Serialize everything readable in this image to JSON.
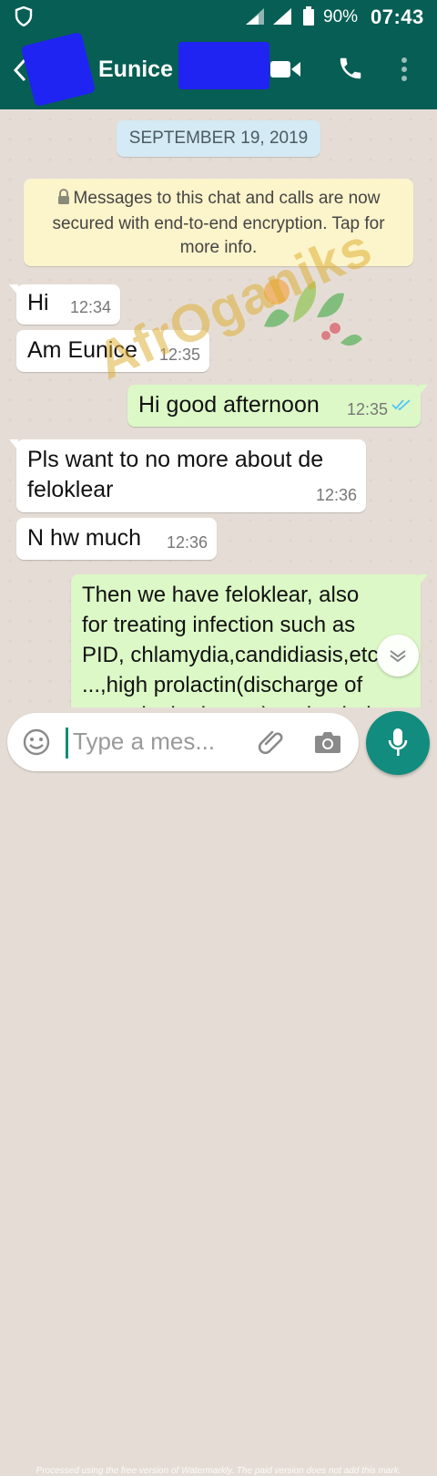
{
  "status_bar": {
    "battery": "90%",
    "time": "07:43"
  },
  "header": {
    "contact_name": "Eunice S"
  },
  "chat": {
    "date_chip": "SEPTEMBER 19, 2019",
    "encryption_line1": "Messages to this chat and calls are now",
    "encryption_line2": "secured with end-to-end encryption. Tap for",
    "encryption_line3": "more info.",
    "messages": [
      {
        "direction": "incoming",
        "line1": "Hi",
        "time": "12:34"
      },
      {
        "direction": "incoming",
        "line1": "Am Eunice",
        "time": "12:35"
      },
      {
        "direction": "outgoing",
        "line1": "Hi good afternoon",
        "time": "12:35",
        "status": "read"
      },
      {
        "direction": "incoming",
        "line1": "Pls want to no more about de",
        "line2": "feloklear",
        "time": "12:36"
      },
      {
        "direction": "incoming",
        "line1": "N hw much",
        "time": "12:36"
      },
      {
        "direction": "outgoing",
        "line1": "Then we have feloklear, also",
        "line2": "for treating infection such as",
        "line3": "PID, chlamydia,candidiasis,etc",
        "line4": "...,high prolactin(discharge of",
        "line5": "water in the breast) and to help"
      }
    ],
    "watermark_text": "AfrOganiks"
  },
  "composer": {
    "placeholder": "Type a mes...",
    "footnote": "Processed using the free version of Watermarkly. The paid version does not add this mark."
  },
  "colors": {
    "header": "#075e54",
    "accent": "#128c7e",
    "outgoing_bubble": "#dcf8c6",
    "incoming_bubble": "#ffffff",
    "read_ticks": "#4fc3f7"
  }
}
